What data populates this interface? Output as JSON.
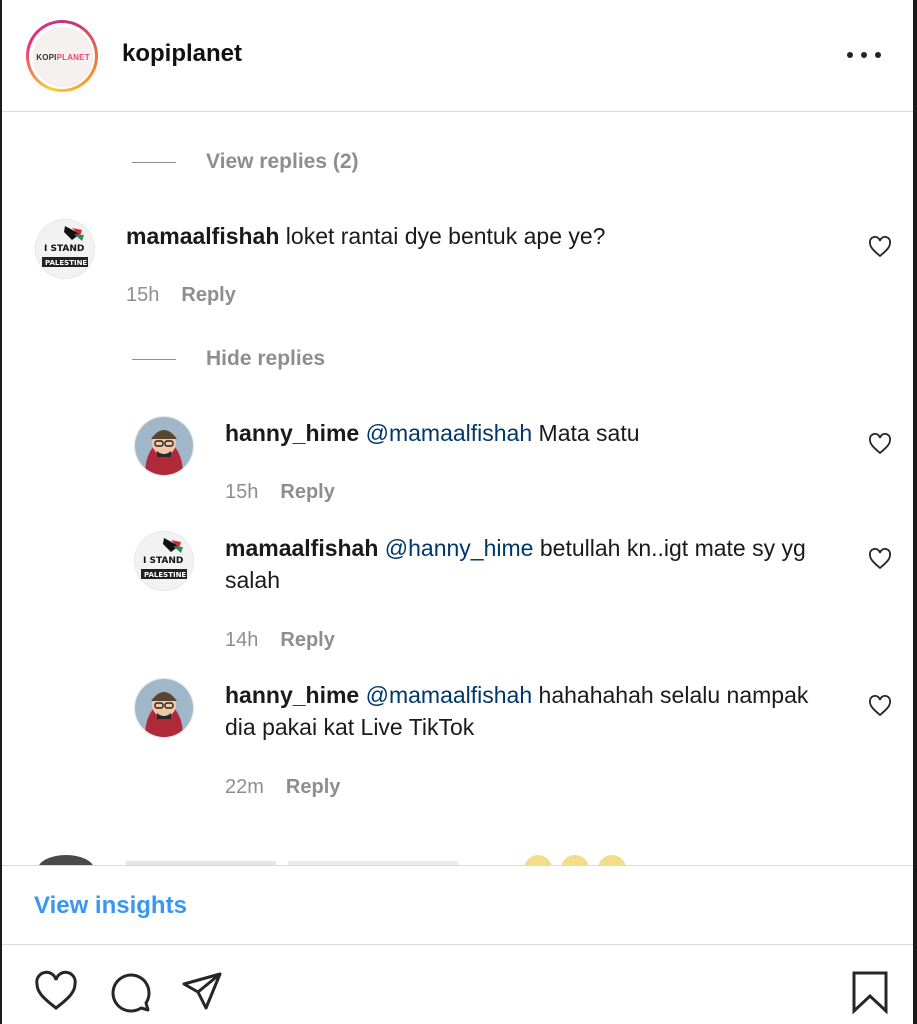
{
  "header": {
    "account_name": "kopiplanet",
    "logo_text_a": "KOPI",
    "logo_text_b": "PLANET"
  },
  "toggles": {
    "view_replies": "View replies (2)",
    "hide_replies": "Hide replies"
  },
  "comments": [
    {
      "user": "mamaalfishah",
      "mention": "",
      "text": "loket rantai dye bentuk ape ye?",
      "time": "15h",
      "reply": "Reply"
    },
    {
      "user": "hanny_hime",
      "mention": "@mamaalfishah",
      "text": "Mata satu",
      "time": "15h",
      "reply": "Reply"
    },
    {
      "user": "mamaalfishah",
      "mention": "@hanny_hime",
      "text": "betullah kn..igt mate sy yg salah",
      "time": "14h",
      "reply": "Reply"
    },
    {
      "user": "hanny_hime",
      "mention": "@mamaalfishah",
      "text": "hahahahah selalu nampak dia pakai kat Live TikTok",
      "time": "22m",
      "reply": "Reply"
    }
  ],
  "footer": {
    "view_insights": "View insights"
  },
  "actions": [
    "heart-icon",
    "comment-icon",
    "share-icon",
    "bookmark-icon"
  ],
  "colors": {
    "link": "#3897f0",
    "mention": "#00376b",
    "muted": "#8e8e8e"
  }
}
